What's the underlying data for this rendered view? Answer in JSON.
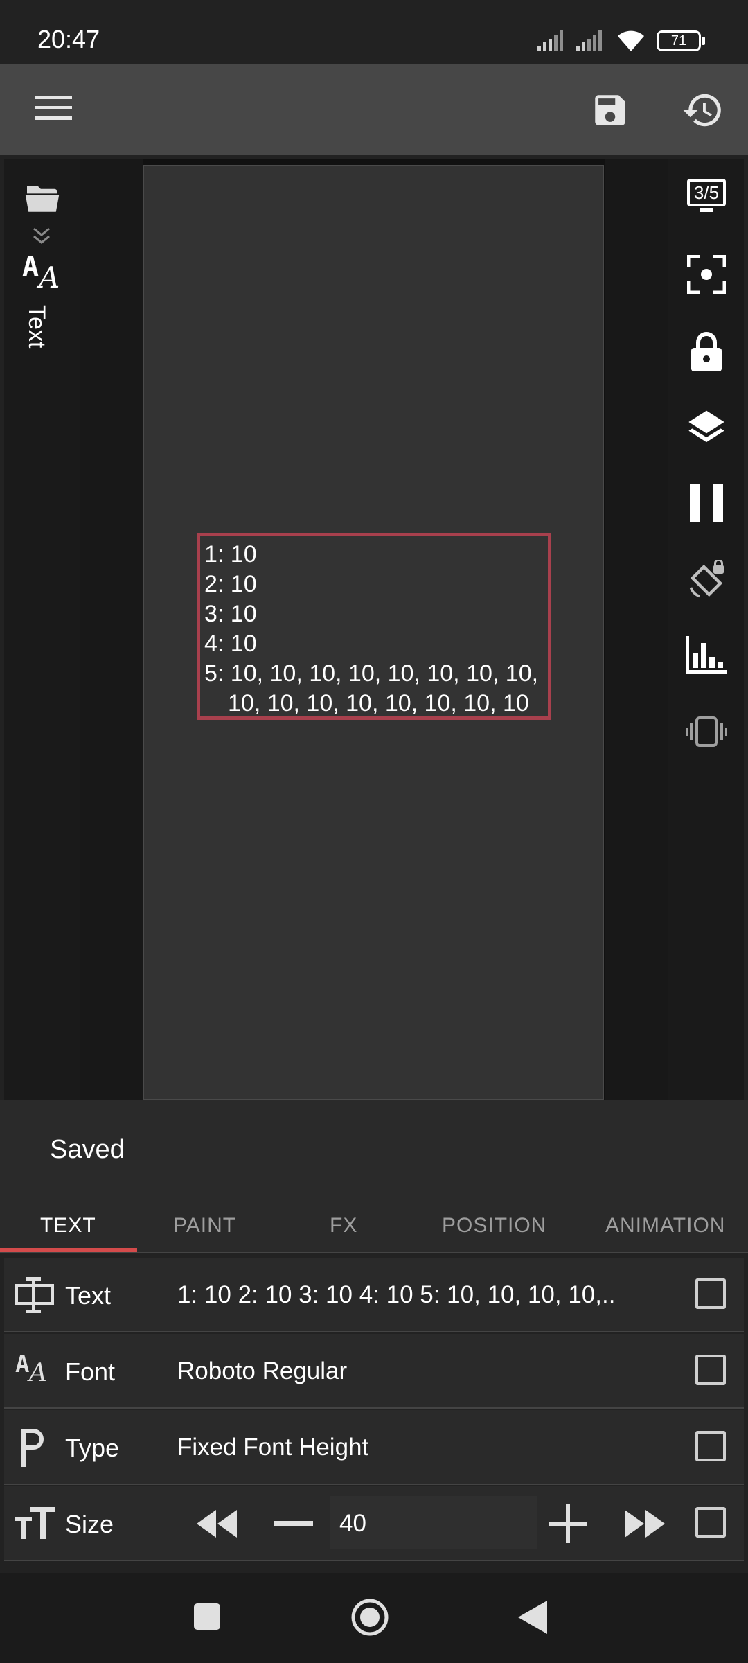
{
  "status_bar": {
    "time": "20:47",
    "battery": "71",
    "icons": [
      "signal-icon",
      "signal-icon",
      "wifi-icon",
      "battery-icon"
    ]
  },
  "toolbar": {
    "icons": [
      "menu-icon",
      "save-icon",
      "history-icon"
    ]
  },
  "left_panel": {
    "icons": [
      "folder-icon",
      "double-chevron-down-icon",
      "text-font-icon"
    ],
    "label": "Text"
  },
  "right_panel": {
    "monitor_badge": "3/5",
    "icons": [
      "monitor-icon",
      "focus-icon",
      "lock-icon",
      "layers-icon",
      "pause-icon",
      "screen-rotation-lock-icon",
      "chart-icon",
      "vibrate-icon"
    ]
  },
  "canvas": {
    "text_lines": [
      "1: 10",
      "2: 10",
      "3: 10",
      "4: 10",
      "5: 10, 10, 10, 10, 10, 10, 10, 10,",
      "10, 10, 10, 10, 10, 10, 10, 10"
    ],
    "selection_color": "#a8404d"
  },
  "snackbar": {
    "text": "Saved"
  },
  "tabs": [
    "TEXT",
    "PAINT",
    "FX",
    "POSITION",
    "ANIMATION"
  ],
  "active_tab": "TEXT",
  "accent_color": "#d44b4b",
  "properties": [
    {
      "icon": "text-field-icon",
      "label": "Text",
      "value": "1: 10 2: 10 3: 10 4: 10 5: 10, 10, 10, 10,.."
    },
    {
      "icon": "font-icon",
      "label": "Font",
      "value": "Roboto Regular"
    },
    {
      "icon": "paragraph-icon",
      "label": "Type",
      "value": "Fixed Font Height"
    },
    {
      "icon": "text-size-icon",
      "label": "Size",
      "value": "40"
    }
  ],
  "nav_bar": {
    "icons": [
      "recents-icon",
      "home-icon",
      "back-icon"
    ]
  }
}
